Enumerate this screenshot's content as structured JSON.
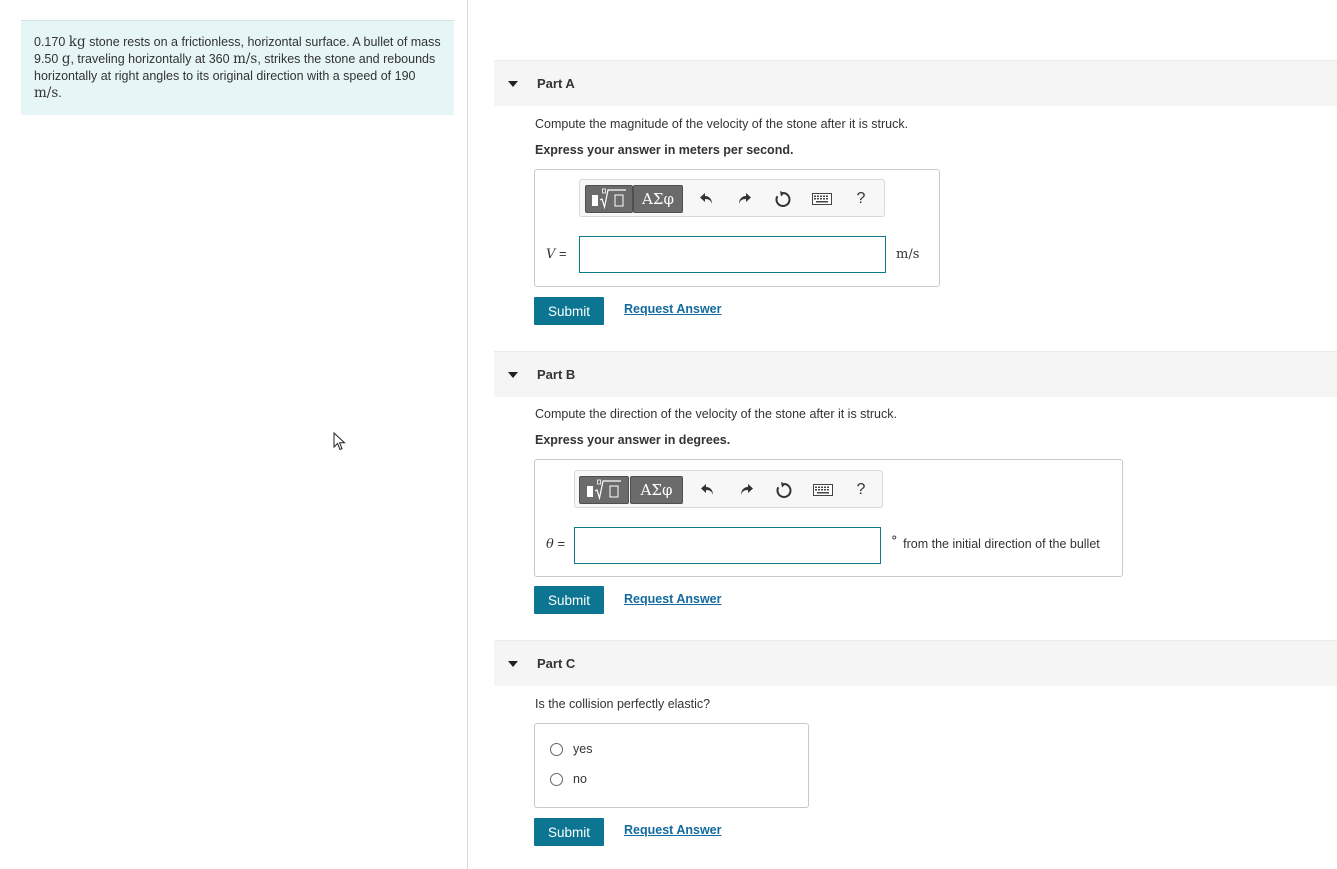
{
  "problem": {
    "mass_stone": "0.170",
    "unit_kg": "kg",
    "text1": " stone rests on a frictionless, horizontal surface. A bullet of mass 9.50 ",
    "unit_g": "g",
    "text2": ", traveling horizontally at 360 ",
    "unit_ms1": "m/s",
    "text3": ", strikes the stone and rebounds horizontally at right angles to its original direction with a speed of 190 ",
    "unit_ms2": "m/s",
    "text4": "."
  },
  "toolbar": {
    "template_icon": "template-sqrt-icon",
    "greek_label": "ΑΣφ",
    "undo_icon": "undo-icon",
    "redo_icon": "redo-icon",
    "reset_icon": "reset-icon",
    "keyboard_icon": "keyboard-icon",
    "help_label": "?"
  },
  "partA": {
    "title": "Part A",
    "prompt": "Compute the magnitude of the velocity of the stone after it is struck.",
    "instruction": "Express your answer in meters per second.",
    "var_label": "V",
    "equals": " =",
    "input_value": "",
    "unit": "m/s",
    "submit_label": "Submit",
    "request_label": "Request Answer"
  },
  "partB": {
    "title": "Part B",
    "prompt": "Compute the direction of the velocity of the stone after it is struck.",
    "instruction": "Express your answer in degrees.",
    "var_label": "θ",
    "equals": " =",
    "input_value": "",
    "unit_degree": "°",
    "unit_text": "from the initial direction of the bullet",
    "submit_label": "Submit",
    "request_label": "Request Answer"
  },
  "partC": {
    "title": "Part C",
    "prompt": "Is the collision perfectly elastic?",
    "options": [
      "yes",
      "no"
    ],
    "submit_label": "Submit",
    "request_label": "Request Answer"
  },
  "colors": {
    "accent": "#0b7592",
    "problem_bg": "#e6f5f6",
    "link": "#136a9e"
  }
}
